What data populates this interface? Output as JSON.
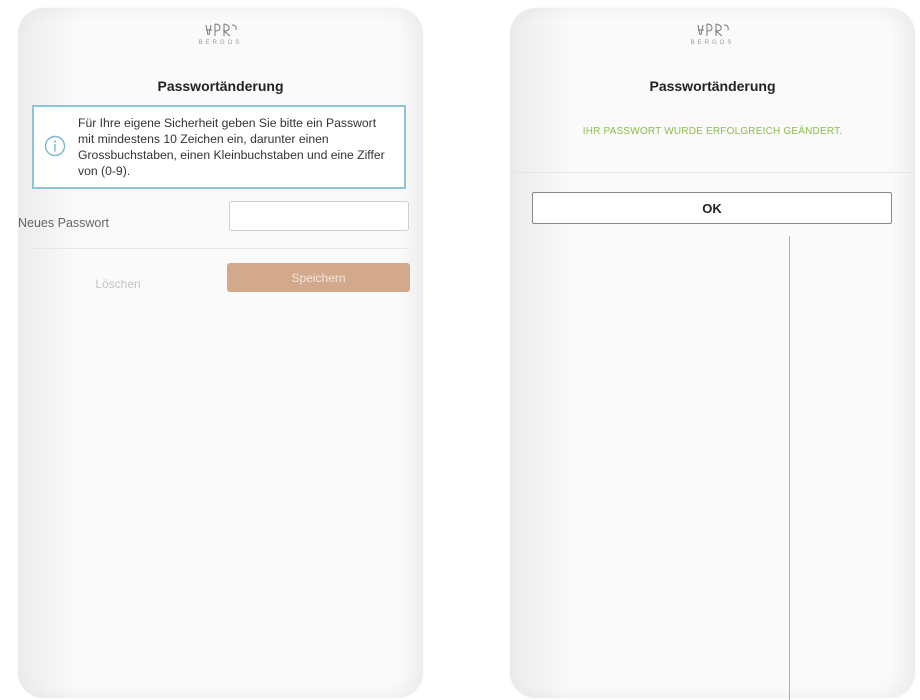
{
  "brand": {
    "logo_subtext": "BERGOS"
  },
  "left_screen": {
    "title": "Passwortänderung",
    "info_text": "Für Ihre eigene Sicherheit geben Sie bitte ein Passwort mit mindestens 10 Zeichen ein, darunter einen Grossbuchstaben, einen Kleinbuchstaben und eine Ziffer von (0-9).",
    "new_password_label": "Neues Passwort",
    "new_password_value": "",
    "clear_label": "Löschen",
    "save_label": "Speichern"
  },
  "right_screen": {
    "title": "Passwortänderung",
    "success_message": "IHR PASSWORT WURDE ERFOLGREICH GEÄNDERT.",
    "ok_label": "OK"
  },
  "colors": {
    "info_border": "#8ec4d8",
    "save_button": "#d3a98c",
    "success_text": "#8bbd4a",
    "accent_line": "#e0a27a"
  },
  "icons": {
    "info": "info-circle-icon",
    "logo": "bergos-logo-icon"
  }
}
